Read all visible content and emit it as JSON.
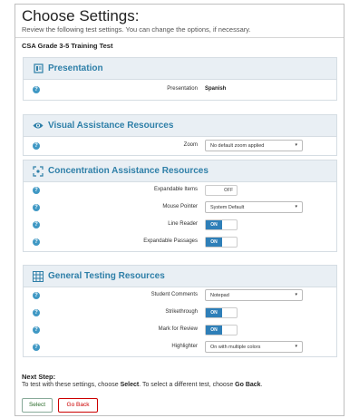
{
  "header": {
    "title": "Choose Settings:",
    "subtitle": "Review the following test settings. You can change the options, if necessary.",
    "test_name": "CSA Grade 3-5 Training Test"
  },
  "sections": {
    "presentation": {
      "title": "Presentation",
      "icon": "presentation-icon",
      "rows": [
        {
          "label": "Presentation",
          "value": "Spanish"
        }
      ]
    },
    "visual": {
      "title": "Visual Assistance Resources",
      "icon": "eye-icon",
      "rows": [
        {
          "label": "Zoom",
          "value": "No default zoom applied"
        }
      ]
    },
    "concentration": {
      "title": "Concentration Assistance Resources",
      "icon": "focus-icon",
      "rows": [
        {
          "label": "Expandable Items",
          "value": "OFF"
        },
        {
          "label": "Mouse Pointer",
          "value": "System Default"
        },
        {
          "label": "Line Reader",
          "value": "ON"
        },
        {
          "label": "Expandable Passages",
          "value": "ON"
        }
      ]
    },
    "general": {
      "title": "General Testing Resources",
      "icon": "grid-icon",
      "rows": [
        {
          "label": "Student Comments",
          "value": "Notepad"
        },
        {
          "label": "Strikethrough",
          "value": "ON"
        },
        {
          "label": "Mark for Review",
          "value": "ON"
        },
        {
          "label": "Highlighter",
          "value": "On with multiple colors"
        }
      ]
    }
  },
  "footer": {
    "next_step_title": "Next Step:",
    "next_text_1": "To test with these settings, choose ",
    "next_select_word": "Select",
    "next_text_2": ". To select a different test, choose ",
    "next_back_word": "Go Back",
    "next_text_3": ".",
    "select_label": "Select",
    "back_label": "Go Back"
  },
  "info_glyph": "?",
  "caret_glyph": "▾",
  "colors": {
    "accent": "#2e7fa8",
    "toggle_on": "#2e7fb8",
    "section_header_bg": "#e9eff4",
    "go_back": "#cc0000"
  }
}
